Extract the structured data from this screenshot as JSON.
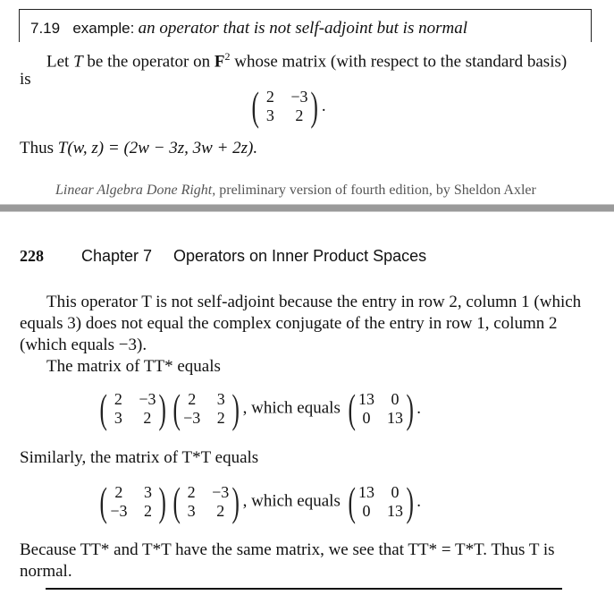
{
  "example": {
    "number": "7.19",
    "label": "example:",
    "title": "an operator that is not self-adjoint but is normal"
  },
  "intro": {
    "line1_a": "Let ",
    "T": "T",
    "line1_b": " be the operator on ",
    "field": "F",
    "field_sup": "2",
    "line1_c": " whose matrix (with respect to the standard basis)",
    "line2": "is"
  },
  "matrix_T": {
    "cells": [
      "2",
      "−3",
      "3",
      "2"
    ],
    "suffix": "."
  },
  "thus_line": {
    "prefix": "Thus ",
    "formula": "T(w, z) = (2w − 3z, 3w + 2z)."
  },
  "footer": {
    "book_title": "Linear Algebra Done Right",
    "rest": ", preliminary version of fourth edition, by Sheldon Axler"
  },
  "running_head": {
    "page_number": "228",
    "chapter": "Chapter 7",
    "chapter_title": "Operators on Inner Product Spaces"
  },
  "paragraph1": {
    "line1": "This operator T is not self-adjoint because the entry in row 2, column 1 (which",
    "line2": "equals 3) does not equal the complex conjugate of the entry in row 1, column 2",
    "line3": "(which equals −3)."
  },
  "tt_star": {
    "intro": "The matrix of TT* equals",
    "m1": [
      "2",
      "−3",
      "3",
      "2"
    ],
    "m2": [
      "2",
      "3",
      "−3",
      "2"
    ],
    "which_equals": ", which equals",
    "result": [
      "13",
      "0",
      "0",
      "13"
    ],
    "suffix": "."
  },
  "t_star_t": {
    "intro": "Similarly, the matrix of T*T equals",
    "m1": [
      "2",
      "3",
      "−3",
      "2"
    ],
    "m2": [
      "2",
      "−3",
      "3",
      "2"
    ],
    "which_equals": ", which equals",
    "result": [
      "13",
      "0",
      "0",
      "13"
    ],
    "suffix": "."
  },
  "conclusion": {
    "line1": "Because TT* and T*T have the same matrix, we see that TT* = T*T. Thus T is",
    "line2": "normal."
  }
}
